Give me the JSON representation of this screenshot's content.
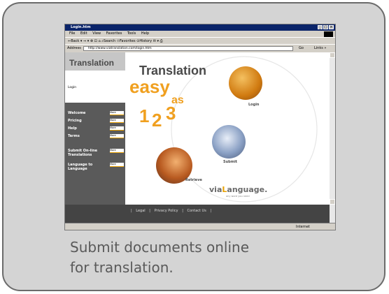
{
  "caption": {
    "line1": "Submit documents online",
    "line2": "for translation."
  },
  "browser": {
    "title": "Login.htm",
    "menu": [
      "File",
      "Edit",
      "View",
      "Favorites",
      "Tools",
      "Help"
    ],
    "toolbar_text": "⇐Back ▾ ⇒ ▾ ⊗ ⊡ ⌂  ⌕Search  ✩Favorites  ⊙History  ✉ ▾ ⎙",
    "address_label": "Address",
    "address_value": "http://www.viatranslation.com/login.htm",
    "go_label": "Go",
    "links_label": "Links »",
    "status_zone": "Internet"
  },
  "sidebar": {
    "heading": "Translation",
    "login_label": "Login",
    "items": [
      {
        "label": "Welcome",
        "btn": "More"
      },
      {
        "label": "Pricing",
        "btn": "More"
      },
      {
        "label": "Help",
        "btn": "More"
      },
      {
        "label": "Terms",
        "btn": "More"
      },
      {
        "label": "Submit On-line Translations",
        "btn": "More"
      },
      {
        "label": "Language to Language",
        "btn": "More"
      }
    ]
  },
  "hero": {
    "title": "Translation",
    "easy": "easy",
    "as": "as",
    "one": "1",
    "two": "2",
    "three": "3",
    "step_login": "Login",
    "step_submit": "Submit",
    "step_retrieve": "Retrieve",
    "brand_prefix": "via",
    "brand_mid": "L",
    "brand_suffix": "anguage.",
    "tagline": "any word you need"
  },
  "footer": {
    "links": [
      "Legal",
      "Privacy Policy",
      "Contact Us"
    ]
  },
  "colors": {
    "accent": "#f0a020",
    "frame_border": "#6b6b6b",
    "frame_bg": "#d4d4d4",
    "caption": "#5a5a5a"
  }
}
